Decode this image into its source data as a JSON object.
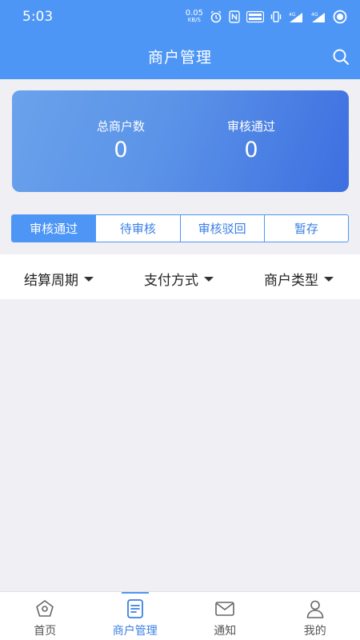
{
  "status_bar": {
    "time": "5:03",
    "net_speed_value": "0.05",
    "net_speed_unit": "KB/S",
    "signal1": "4G",
    "signal2": "4G"
  },
  "header": {
    "title": "商户管理"
  },
  "summary": {
    "total_label": "总商户数",
    "total_value": "0",
    "approved_label": "审核通过",
    "approved_value": "0"
  },
  "tabs": [
    {
      "label": "审核通过",
      "active": true
    },
    {
      "label": "待审核",
      "active": false
    },
    {
      "label": "审核驳回",
      "active": false
    },
    {
      "label": "暂存",
      "active": false
    }
  ],
  "filters": [
    {
      "label": "结算周期"
    },
    {
      "label": "支付方式"
    },
    {
      "label": "商户类型"
    }
  ],
  "bottom_nav": [
    {
      "label": "首页",
      "icon": "home-icon"
    },
    {
      "label": "商户管理",
      "icon": "document-icon",
      "active": true
    },
    {
      "label": "通知",
      "icon": "mail-icon"
    },
    {
      "label": "我的",
      "icon": "user-icon"
    }
  ],
  "colors": {
    "primary": "#4d96f6",
    "card_gradient_start": "#6aa2ec",
    "card_gradient_end": "#3d6fe0",
    "background": "#efeff4"
  }
}
